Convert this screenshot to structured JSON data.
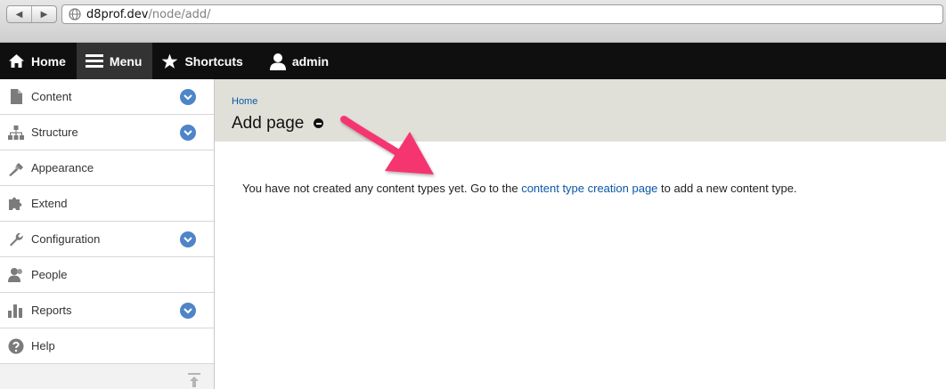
{
  "browser": {
    "url_host": "d8prof.dev",
    "url_path": "/node/add/",
    "back_glyph": "◀",
    "forward_glyph": "▶"
  },
  "toolbar": {
    "items": [
      {
        "label": "Home",
        "icon": "home-icon"
      },
      {
        "label": "Menu",
        "icon": "hamburger-menu-icon",
        "active": true
      },
      {
        "label": "Shortcuts",
        "icon": "star-icon"
      },
      {
        "label": "admin",
        "icon": "user-icon"
      }
    ]
  },
  "sidebar": {
    "items": [
      {
        "label": "Content",
        "icon": "file-icon",
        "expandable": true
      },
      {
        "label": "Structure",
        "icon": "sitemap-icon",
        "expandable": true
      },
      {
        "label": "Appearance",
        "icon": "paintbrush-icon",
        "expandable": false
      },
      {
        "label": "Extend",
        "icon": "puzzle-icon",
        "expandable": false
      },
      {
        "label": "Configuration",
        "icon": "wrench-icon",
        "expandable": true
      },
      {
        "label": "People",
        "icon": "people-icon",
        "expandable": false
      },
      {
        "label": "Reports",
        "icon": "bar-chart-icon",
        "expandable": true
      },
      {
        "label": "Help",
        "icon": "help-icon",
        "expandable": false
      }
    ]
  },
  "header": {
    "breadcrumb": "Home",
    "title": "Add page"
  },
  "message": {
    "before": "You have not created any content types yet. Go to the ",
    "link": "content type creation page",
    "after": " to add a new content type."
  },
  "colors": {
    "toolbar_bg": "#0f0f0f",
    "header_bg": "#e0e0d8",
    "link": "#0a57a6",
    "expand_button": "#4e85c9",
    "annotation_arrow": "#f5346f"
  }
}
